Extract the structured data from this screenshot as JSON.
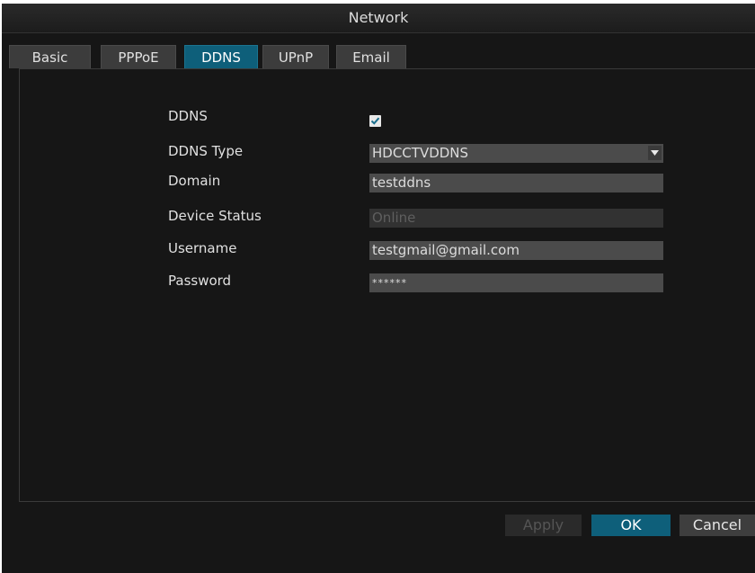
{
  "window": {
    "title": "Network"
  },
  "tabs": [
    {
      "label": "Basic",
      "active": false
    },
    {
      "label": "PPPoE",
      "active": false
    },
    {
      "label": "DDNS",
      "active": true
    },
    {
      "label": "UPnP",
      "active": false
    },
    {
      "label": "Email",
      "active": false
    }
  ],
  "form": {
    "ddns": {
      "label": "DDNS",
      "checked": true
    },
    "ddns_type": {
      "label": "DDNS Type",
      "value": "HDCCTVDDNS"
    },
    "domain": {
      "label": "Domain",
      "value": "testddns"
    },
    "device_status": {
      "label": "Device Status",
      "value": "Online"
    },
    "username": {
      "label": "Username",
      "value": "testgmail@gmail.com"
    },
    "password": {
      "label": "Password",
      "value": "******"
    }
  },
  "buttons": {
    "apply": "Apply",
    "ok": "OK",
    "cancel": "Cancel"
  },
  "colors": {
    "accent": "#0e5f7a",
    "field": "#4b4b4b",
    "background": "#161616"
  },
  "icons": {
    "checkbox": "check-icon",
    "dropdown": "caret-down-icon"
  }
}
